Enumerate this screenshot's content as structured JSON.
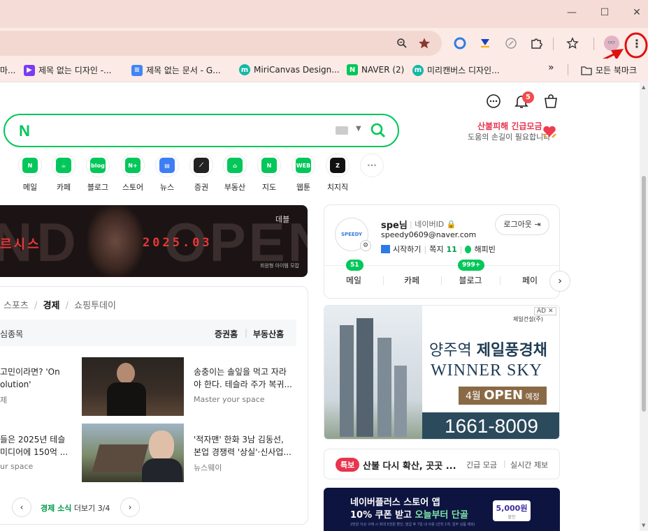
{
  "bookmarks": [
    {
      "label": "마...",
      "color": "#d14b3a"
    },
    {
      "label": "제목 없는 디자인 -...",
      "color": "#7d3bef"
    },
    {
      "label": "제목 없는 문서 - G...",
      "color": "#4285f4"
    },
    {
      "label": "MiriCanvas Design...",
      "color": "#14b8a6"
    },
    {
      "label": "NAVER (2)",
      "color": "#03c75a"
    },
    {
      "label": "미리캔버스 디자인...",
      "color": "#14b8a6"
    },
    {
      "label": "»",
      "color": ""
    },
    {
      "label": "모든 북마크",
      "color": ""
    }
  ],
  "header": {
    "badge_count": "5",
    "fire_title": "산불피해 긴급모금",
    "fire_sub": "도움의 손길이 필요합니다"
  },
  "shortcuts": [
    {
      "label": "메일",
      "color": "#03c75a",
      "glyph": "N"
    },
    {
      "label": "카페",
      "color": "#03c75a",
      "glyph": "☕"
    },
    {
      "label": "블로그",
      "color": "#03c75a",
      "glyph": "blog"
    },
    {
      "label": "스토어",
      "color": "#03c75a",
      "glyph": "N+"
    },
    {
      "label": "뉴스",
      "color": "#3d7ef5",
      "glyph": "▤"
    },
    {
      "label": "증권",
      "color": "#222",
      "glyph": "⟋"
    },
    {
      "label": "부동산",
      "color": "#03c75a",
      "glyph": "⌂"
    },
    {
      "label": "지도",
      "color": "#03c75a",
      "glyph": "N"
    },
    {
      "label": "웹툰",
      "color": "#03c75a",
      "glyph": "WEB"
    },
    {
      "label": "치지직",
      "color": "#111",
      "glyph": "Z"
    },
    {
      "label": "",
      "color": "#999",
      "glyph": "···"
    }
  ],
  "banner": {
    "left_text": "ND",
    "right_text": "OPEN",
    "red_text": "르시스",
    "date": "2025.03",
    "brand": "데블",
    "sub": "회원형 아이템 모잡"
  },
  "news": {
    "tabs": [
      "스포츠",
      "경제",
      "쇼핑투데이"
    ],
    "active_tab": "경제",
    "sub_left": "심종목",
    "sub_links": [
      "증권홈",
      "부동산홈"
    ],
    "items": [
      {
        "title_l1": "고민이라면? 'On",
        "title_l2": "olution'",
        "src": "제"
      },
      {
        "title_l1": "송충이는 솔잎을 먹고 자라",
        "title_l2": "야 한다. 테슬라 주가 복귀...",
        "src": "Master your space"
      },
      {
        "title_l1": "들은 2025년 테슬",
        "title_l2": "미디어에 150억 ...",
        "src": "ur space"
      },
      {
        "title_l1": "'적자맨' 한화 3남 김동선,",
        "title_l2": "본업 경쟁력 '상실'·신사업...",
        "src": "뉴스웨이"
      }
    ],
    "pager_label": "경제 소식",
    "pager_more": "더보기",
    "pager_page": "3/4"
  },
  "login": {
    "name": "spe님",
    "naver_id_label": "네이버ID",
    "email": "speedy0609@naver.com",
    "start_label": "시작하기",
    "note_label": "쪽지",
    "note_count": "11",
    "happybean": "해피빈",
    "logout": "로그아웃",
    "avatar_text": "SPEEDY",
    "services": [
      {
        "label": "메일",
        "badge": "51"
      },
      {
        "label": "카페",
        "badge": ""
      },
      {
        "label": "블로그",
        "badge": "999+"
      },
      {
        "label": "페이",
        "badge": ""
      }
    ]
  },
  "ad": {
    "ad_label": "AD",
    "brand": "제일건설(주)",
    "title_a": "양주역 ",
    "title_b": "제일풍경채",
    "winner": "WINNER SKY",
    "open_prefix": "4월 ",
    "open": "OPEN",
    "open_suffix": " 예정",
    "phone": "1661-8009"
  },
  "fire_news": {
    "tag": "특보",
    "headline": "산불 다시 확산, 곳곳 ...",
    "link1": "긴급 모금",
    "link2": "실시간 제보"
  },
  "store_ad": {
    "line1": "네이버플러스 스토어 앱",
    "line2a": "10% 쿠폰 받고 ",
    "line2b": "오늘부터 단골",
    "coupon": "5,000원",
    "coupon_sub": "할인",
    "fine": "2만원 이상 구매 시 최대 5천원 할인, 발급 후 7일 내 사용 (선착 1개, 일부 상품 제외)"
  }
}
